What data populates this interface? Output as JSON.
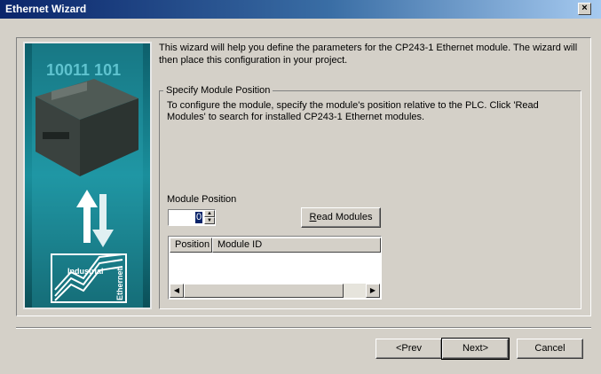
{
  "window": {
    "title": "Ethernet Wizard",
    "close_glyph": "×"
  },
  "intro_text": "This wizard will help you define the parameters for the CP243-1 Ethernet module. The wizard will then place this configuration in your project.",
  "group": {
    "legend": "Specify Module Position",
    "description": "To configure the module, specify the module's position relative to the PLC. Click 'Read Modules' to search for installed CP243-1 Ethernet modules.",
    "position_label": "Module Position",
    "position_value": "0",
    "read_modules_label": "Read Modules",
    "read_modules_accel": "R",
    "read_modules_rest": "ead Modules",
    "list_columns": [
      "Position",
      "Module ID"
    ]
  },
  "image": {
    "binary_text": "10011 101",
    "badge_line1": "Industrial",
    "badge_line2": "Ethernet"
  },
  "buttons": {
    "prev": "<Prev",
    "prev_accel": "P",
    "next": "Next>",
    "next_accel": "N",
    "cancel": "Cancel"
  },
  "colors": {
    "titlebar_start": "#0a246a",
    "titlebar_end": "#a6caf0",
    "dialog_bg": "#d4d0c8",
    "image_bg": "#08353d"
  }
}
